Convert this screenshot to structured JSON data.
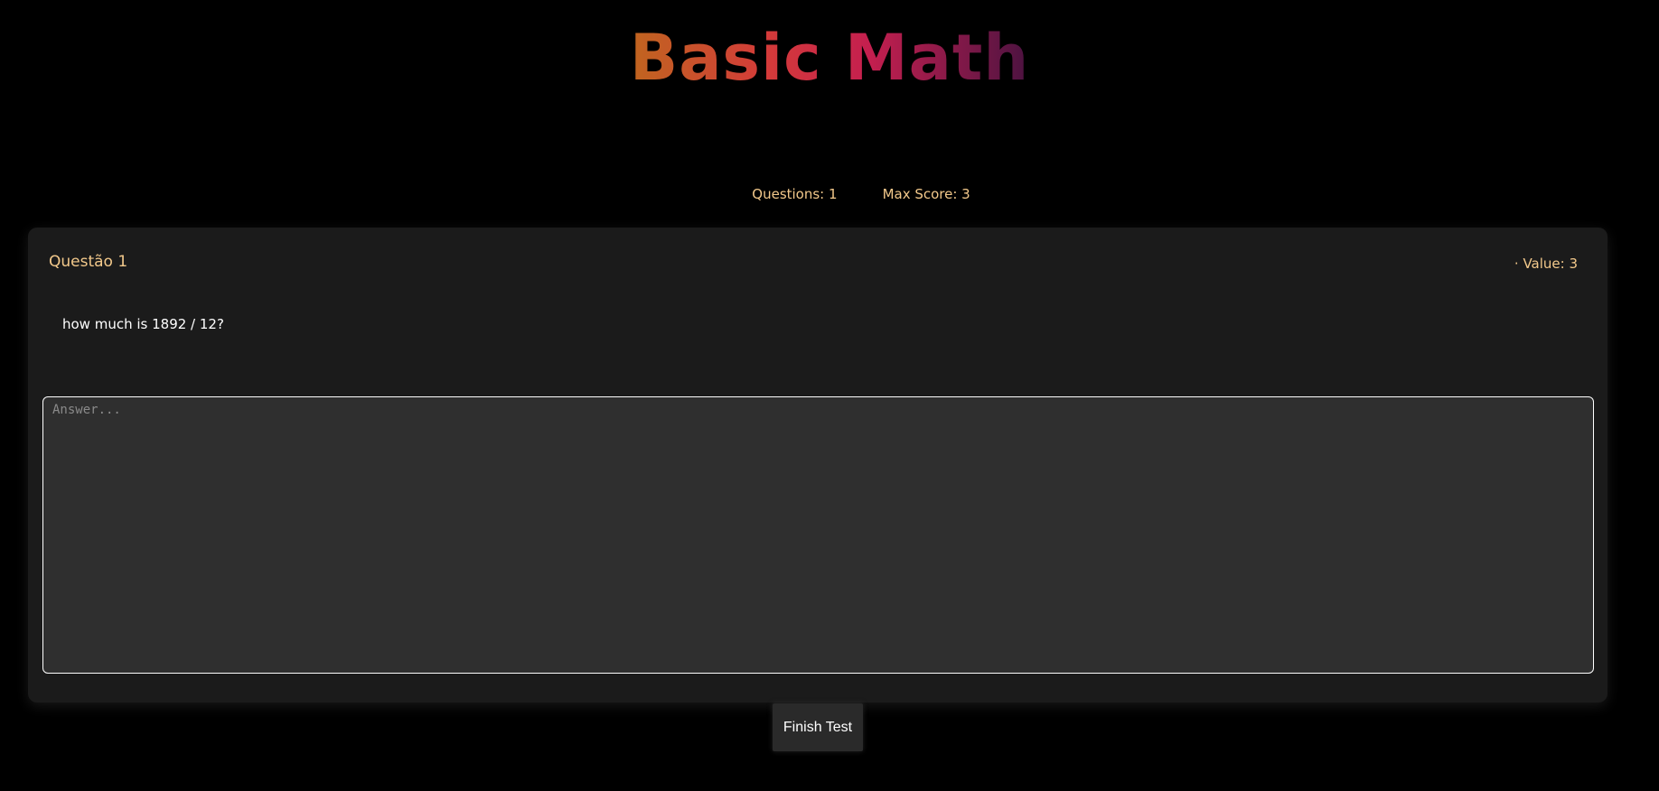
{
  "header": {
    "title": "Basic Math"
  },
  "stats": {
    "questions_label": "Questions: 1",
    "max_score_label": "Max Score: 3"
  },
  "question": {
    "title": "Questão 1",
    "value_label": "· Value: 3",
    "text": "how much is 1892 / 12?",
    "answer_value": "",
    "answer_placeholder": "Answer..."
  },
  "actions": {
    "finish_label": "Finish Test"
  },
  "colors": {
    "background": "#000000",
    "card": "#1b1b1b",
    "accent_text": "#f3c98b",
    "title_gradient_start": "#c0651f",
    "title_gradient_end": "#4b1240"
  }
}
